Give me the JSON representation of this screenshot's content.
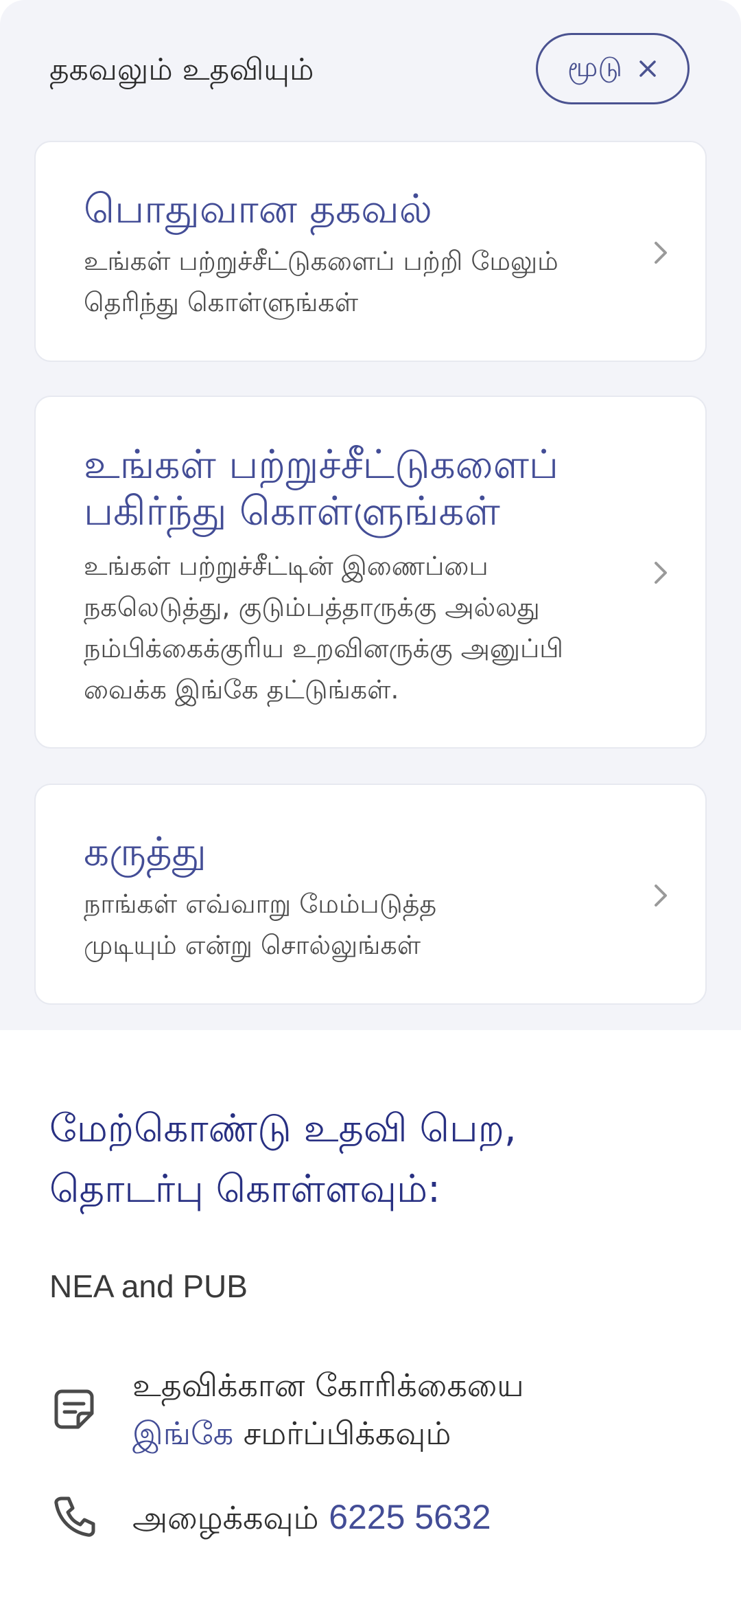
{
  "header": {
    "title": "தகவலும் உதவியும்",
    "close_label": "மூடு"
  },
  "cards": [
    {
      "title_lines": [
        "பொதுவான தகவல்"
      ],
      "desc_lines": [
        "உங்கள் பற்றுச்சீட்டுகளைப் பற்றி மேலும்",
        "தெரிந்து கொள்ளுங்கள்"
      ]
    },
    {
      "title_lines": [
        "உங்கள் பற்றுச்சீட்டுகளைப்",
        "பகிர்ந்து கொள்ளுங்கள்"
      ],
      "desc_lines": [
        "உங்கள் பற்றுச்சீட்டின் இணைப்பை",
        "நகலெடுத்து, குடும்பத்தாருக்கு அல்லது",
        "நம்பிக்கைக்குரிய உறவினருக்கு அனுப்பி",
        "வைக்க இங்கே தட்டுங்கள்."
      ]
    },
    {
      "title_lines": [
        "கருத்து"
      ],
      "desc_lines": [
        "நாங்கள் எவ்வாறு மேம்படுத்த",
        "முடியும் என்று சொல்லுங்கள்"
      ]
    }
  ],
  "help": {
    "heading_lines": [
      "மேற்கொண்டு உதவி பெற,",
      "தொடர்பு கொள்ளவும்:"
    ],
    "org_name": "NEA and PUB",
    "request_line1": "உதவிக்கான கோரிக்கையை",
    "request_link": "இங்கே",
    "request_line2_rest": " சமர்ப்பிக்கவும்",
    "call_label": "அழைக்கவும் ",
    "phone": "6225 5632"
  },
  "icons": {
    "close": "close-icon",
    "chevron": "chevron-right-icon",
    "form": "form-icon",
    "phone": "phone-icon"
  },
  "colors": {
    "accent": "#434d96",
    "heading": "#283082",
    "top_background": "#f3f4f9",
    "icon_gray": "#9a9a9a"
  }
}
